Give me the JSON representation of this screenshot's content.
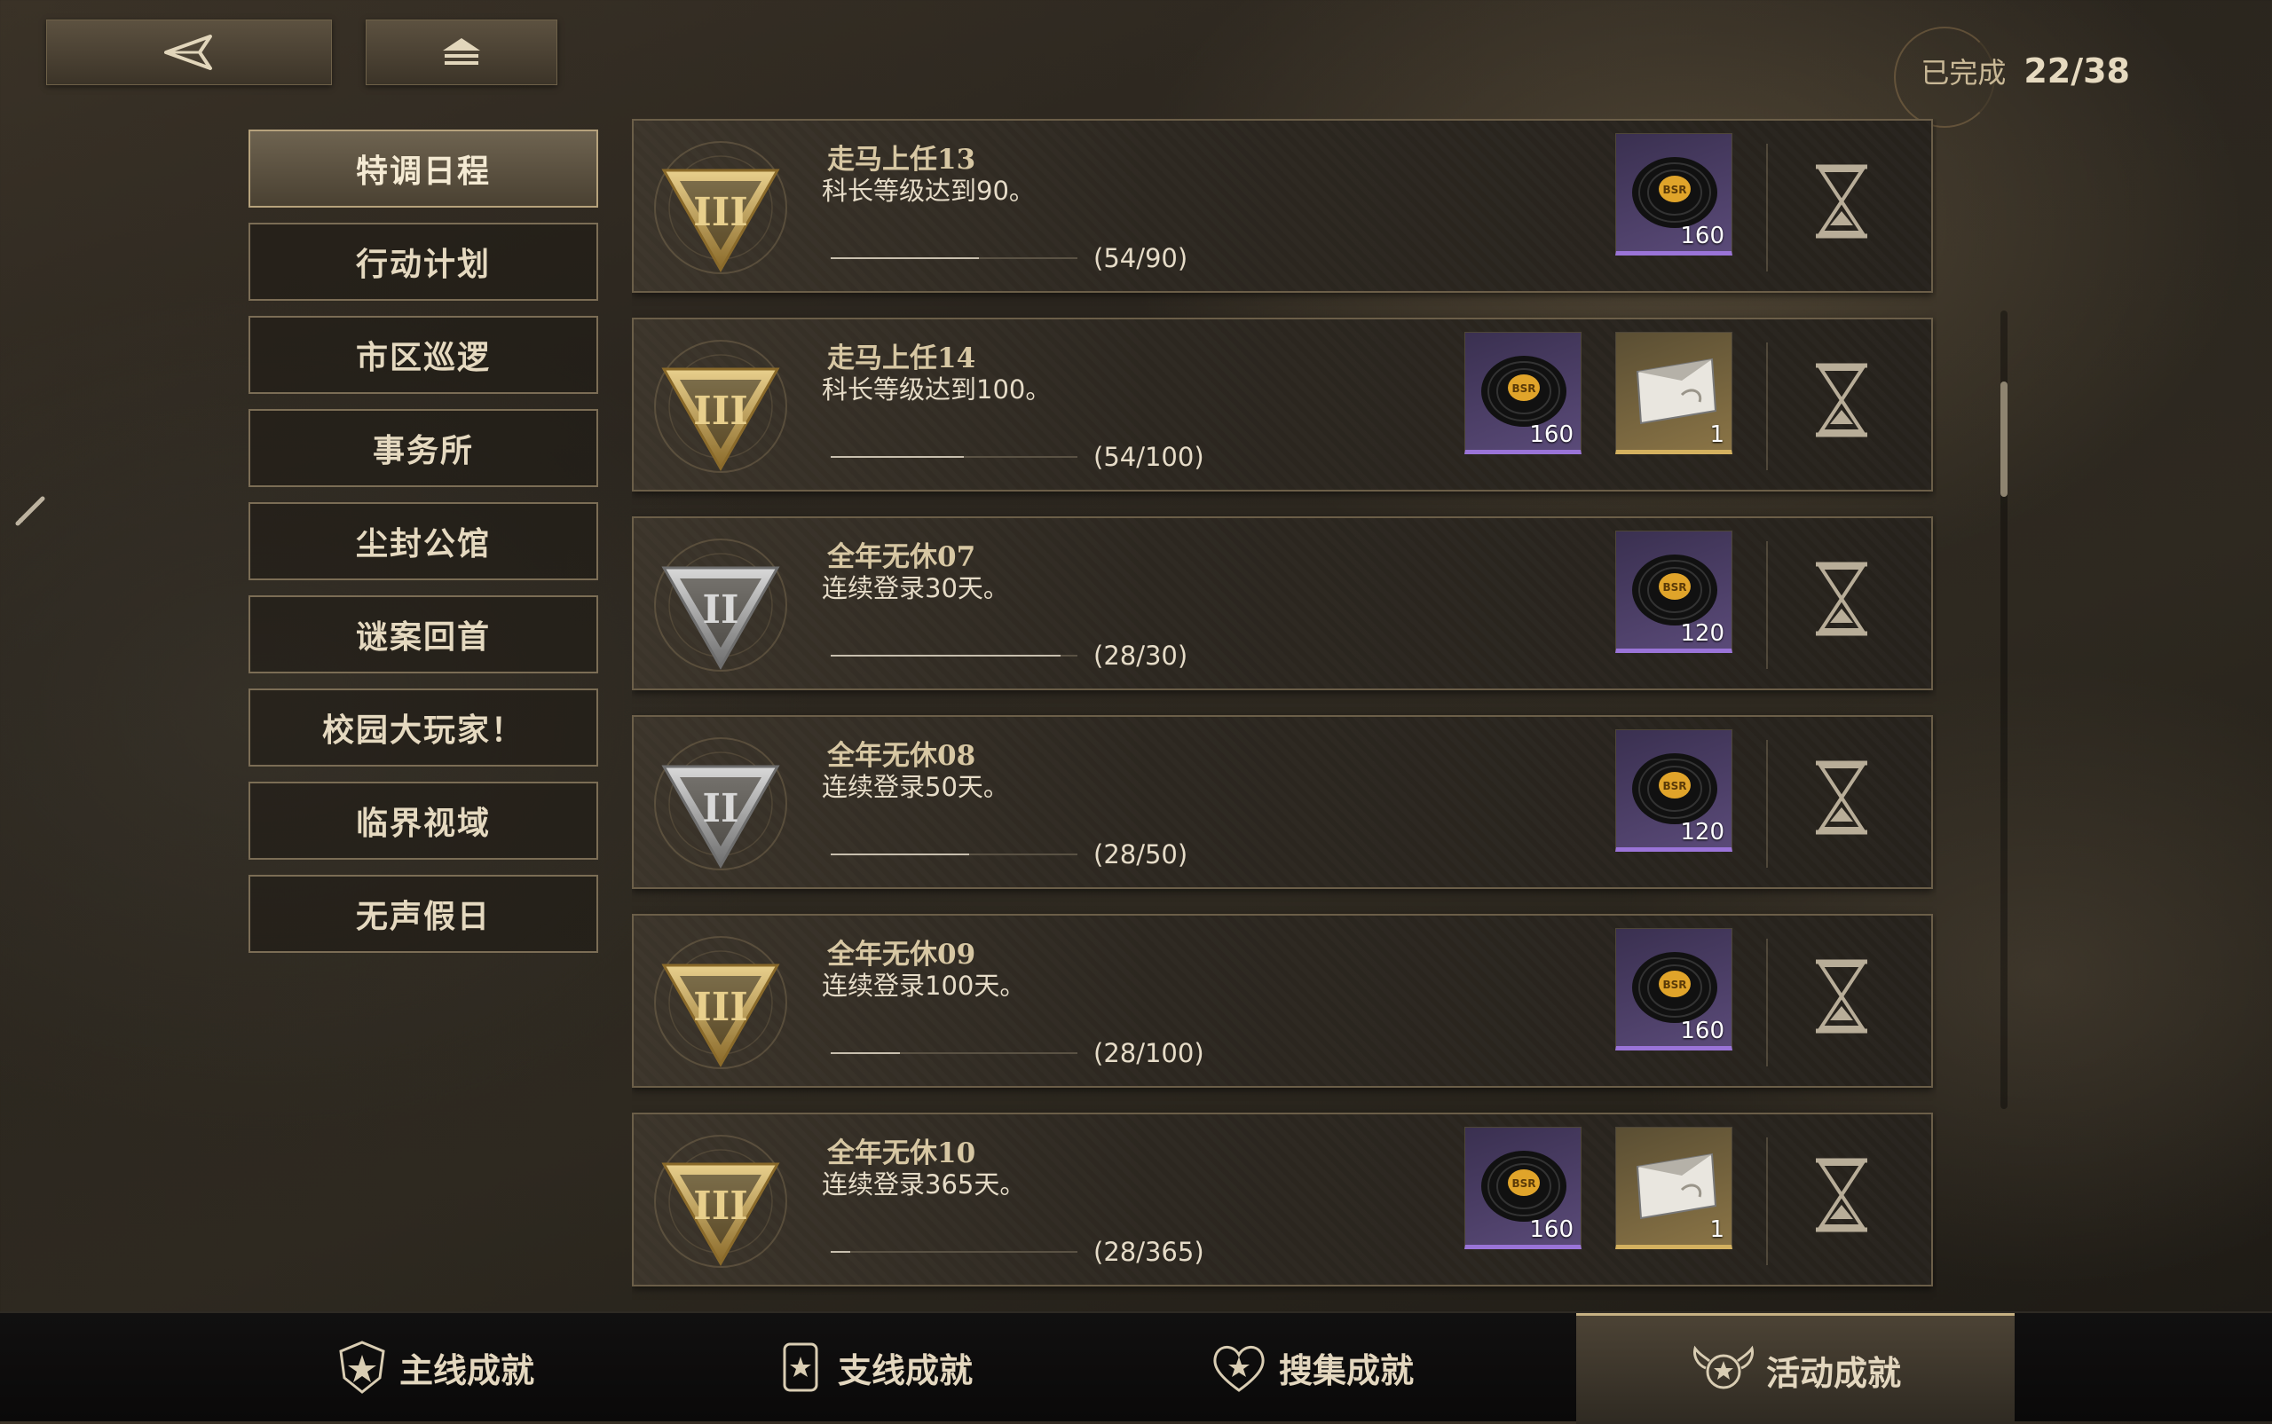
{
  "header": {
    "back_icon": "back-arrow-icon",
    "home_icon": "home-icon",
    "completed_label": "已完成",
    "completed_value": "22/38"
  },
  "sidebar": {
    "items": [
      {
        "label": "特调日程",
        "active": true
      },
      {
        "label": "行动计划",
        "active": false
      },
      {
        "label": "市区巡逻",
        "active": false
      },
      {
        "label": "事务所",
        "active": false
      },
      {
        "label": "尘封公馆",
        "active": false
      },
      {
        "label": "谜案回首",
        "active": false
      },
      {
        "label": "校园大玩家！",
        "active": false
      },
      {
        "label": "临界视域",
        "active": false
      },
      {
        "label": "无声假日",
        "active": false
      }
    ]
  },
  "achievements": [
    {
      "title": "走马上任13",
      "desc": "科长等级达到90。",
      "progress": "(54/90)",
      "fraction": 0.6,
      "tier": "gold",
      "rewards": [
        {
          "type": "disc",
          "qty": "160"
        }
      ]
    },
    {
      "title": "走马上任14",
      "desc": "科长等级达到100。",
      "progress": "(54/100)",
      "fraction": 0.54,
      "tier": "gold",
      "rewards": [
        {
          "type": "disc",
          "qty": "160"
        },
        {
          "type": "ticket",
          "qty": "1"
        }
      ]
    },
    {
      "title": "全年无休07",
      "desc": "连续登录30天。",
      "progress": "(28/30)",
      "fraction": 0.93,
      "tier": "silver",
      "rewards": [
        {
          "type": "disc",
          "qty": "120"
        }
      ]
    },
    {
      "title": "全年无休08",
      "desc": "连续登录50天。",
      "progress": "(28/50)",
      "fraction": 0.56,
      "tier": "silver",
      "rewards": [
        {
          "type": "disc",
          "qty": "120"
        }
      ]
    },
    {
      "title": "全年无休09",
      "desc": "连续登录100天。",
      "progress": "(28/100)",
      "fraction": 0.28,
      "tier": "gold",
      "rewards": [
        {
          "type": "disc",
          "qty": "160"
        }
      ]
    },
    {
      "title": "全年无休10",
      "desc": "连续登录365天。",
      "progress": "(28/365)",
      "fraction": 0.08,
      "tier": "gold",
      "rewards": [
        {
          "type": "disc",
          "qty": "160"
        },
        {
          "type": "ticket",
          "qty": "1"
        }
      ]
    }
  ],
  "bottom_tabs": [
    {
      "label": "主线成就",
      "icon": "shield-star-icon",
      "active": false
    },
    {
      "label": "支线成就",
      "icon": "badge-star-icon",
      "active": false
    },
    {
      "label": "搜集成就",
      "icon": "heart-star-icon",
      "active": false
    },
    {
      "label": "活动成就",
      "icon": "winged-star-icon",
      "active": true
    }
  ]
}
